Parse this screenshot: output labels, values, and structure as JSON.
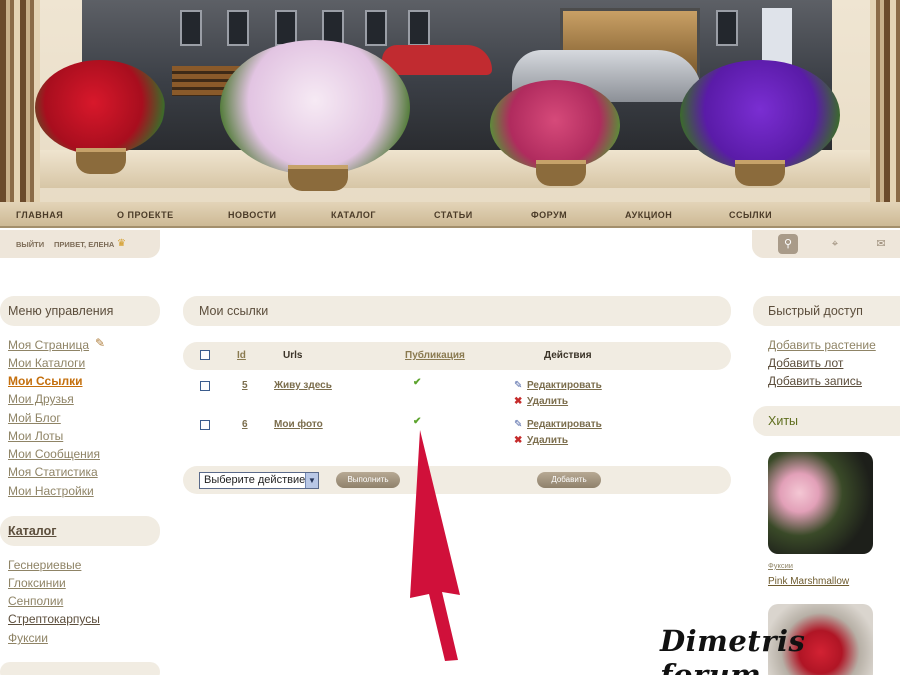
{
  "nav": {
    "items": [
      "ГЛАВНАЯ",
      "О ПРОЕКТЕ",
      "НОВОСТИ",
      "КАТАЛОГ",
      "СТАТЬИ",
      "ФОРУМ",
      "АУКЦИОН",
      "ССЫЛКИ"
    ]
  },
  "userbar": {
    "logout": "ВЫЙТИ",
    "greeting": "ПРИВЕТ, ЕЛЕНА"
  },
  "left_menu": {
    "title": "Меню управления",
    "items": [
      "Моя Страница",
      "Мои Каталоги",
      "Мои Ссылки",
      "Мои Друзья",
      "Мой Блог",
      "Мои Лоты",
      "Мои Сообщения",
      "Моя Статистика",
      "Мои Настройки"
    ],
    "active": "Мои Ссылки"
  },
  "catalog": {
    "title": "Каталог",
    "items": [
      "Геснериевые",
      "Глоксинии",
      "Сенполии",
      "Стрептокарпусы",
      "Фуксии"
    ]
  },
  "main": {
    "title": "Мои ссылки",
    "columns": [
      "Id",
      "Urls",
      "Публикация",
      "Действия"
    ],
    "rows": [
      {
        "id": "5",
        "url": "Живу здесь",
        "published": true,
        "edit": "Редактировать",
        "delete": "Удалить"
      },
      {
        "id": "6",
        "url": "Мои фото",
        "published": true,
        "edit": "Редактировать",
        "delete": "Удалить"
      }
    ],
    "select_value": "Выберите действие",
    "execute_button": "Выполнить",
    "add_button": "Добавить"
  },
  "quick_access": {
    "title": "Быстрый доступ",
    "items": [
      "Добавить растение",
      "Добавить лот",
      "Добавить запись"
    ]
  },
  "hits": {
    "title": "Хиты",
    "items": [
      {
        "category": "Фуксии",
        "name": "Pink Marshmallow"
      }
    ]
  },
  "watermark": "Dimetris forum",
  "colors": {
    "accent_active": "#c46f0d",
    "arrow": "#d0103a",
    "check": "#5da42e"
  }
}
